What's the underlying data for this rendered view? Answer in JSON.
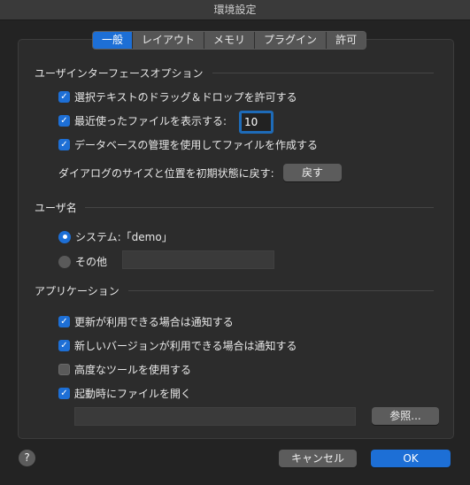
{
  "window": {
    "title": "環境設定"
  },
  "tabs": [
    {
      "label": "一般",
      "active": true
    },
    {
      "label": "レイアウト",
      "active": false
    },
    {
      "label": "メモリ",
      "active": false
    },
    {
      "label": "プラグイン",
      "active": false
    },
    {
      "label": "許可",
      "active": false
    }
  ],
  "ui_options": {
    "title": "ユーザインターフェースオプション",
    "drag_drop": {
      "label": "選択テキストのドラッグ＆ドロップを許可する",
      "checked": true
    },
    "recent_files": {
      "label": "最近使ったファイルを表示する:",
      "checked": true,
      "value": "10"
    },
    "database": {
      "label": "データベースの管理を使用してファイルを作成する",
      "checked": true
    },
    "reset_dialogs": {
      "label": "ダイアログのサイズと位置を初期状態に戻す:",
      "button": "戻す"
    }
  },
  "user_name": {
    "title": "ユーザ名",
    "system": {
      "label": "システム:「demo」",
      "selected": true
    },
    "other": {
      "label": "その他",
      "selected": false,
      "value": ""
    }
  },
  "application": {
    "title": "アプリケーション",
    "notify_updates": {
      "label": "更新が利用できる場合は通知する",
      "checked": true
    },
    "notify_new_version": {
      "label": "新しいバージョンが利用できる場合は通知する",
      "checked": true
    },
    "advanced_tools": {
      "label": "高度なツールを使用する",
      "checked": false
    },
    "open_on_launch": {
      "label": "起動時にファイルを開く",
      "checked": true
    },
    "file_path": "",
    "browse_button": "参照..."
  },
  "footer": {
    "help": "?",
    "cancel": "キャンセル",
    "ok": "OK"
  },
  "colors": {
    "accent": "#1d6fd6",
    "background": "#232323"
  }
}
